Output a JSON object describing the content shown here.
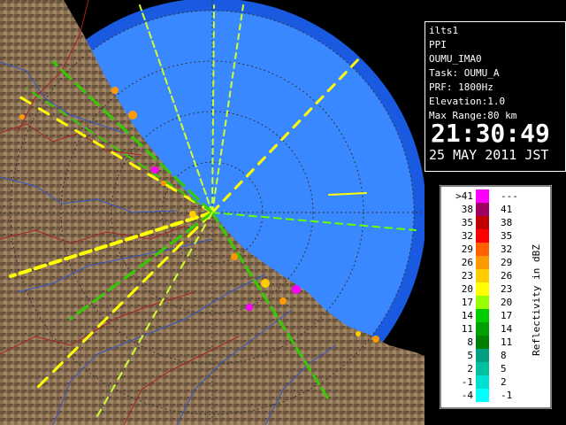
{
  "info": {
    "radar_name": "ilts1",
    "product": "PPI",
    "site": "OUMU_IMA0",
    "task": "Task: OUMU_A",
    "prf": "PRF: 1800Hz",
    "elevation": "Elevation:1.0",
    "max_range": "Max Range:80 km",
    "time": "21:30:49",
    "date": "25 MAY 2011 JST"
  },
  "legend": {
    "title": "Reflectivity in dBZ",
    "rows": [
      {
        "low": ">41",
        "high": "---",
        "color": "#ff00ff"
      },
      {
        "low": "38",
        "high": "41",
        "color": "#a00060"
      },
      {
        "low": "35",
        "high": "38",
        "color": "#c00000"
      },
      {
        "low": "32",
        "high": "35",
        "color": "#ff0000"
      },
      {
        "low": "29",
        "high": "32",
        "color": "#ff6000"
      },
      {
        "low": "26",
        "high": "29",
        "color": "#ff9900"
      },
      {
        "low": "23",
        "high": "26",
        "color": "#ffcc00"
      },
      {
        "low": "20",
        "high": "23",
        "color": "#ffff00"
      },
      {
        "low": "17",
        "high": "20",
        "color": "#99ff00"
      },
      {
        "low": "14",
        "high": "17",
        "color": "#00cc00"
      },
      {
        "low": "11",
        "high": "14",
        "color": "#00a000"
      },
      {
        "low": "8",
        "high": "11",
        "color": "#008000"
      },
      {
        "low": "5",
        "high": "8",
        "color": "#00a080"
      },
      {
        "low": "2",
        "high": "5",
        "color": "#00c0a0"
      },
      {
        "low": "-1",
        "high": "2",
        "color": "#00e0d0"
      },
      {
        "low": "-4",
        "high": "-1",
        "color": "#00ffff"
      }
    ]
  },
  "colors": {
    "radar_range": "#3a88ff",
    "radar_edge": "#1a5ae0",
    "land": "#8a7050",
    "river": "#3355cc",
    "boundary": "#aa2222"
  }
}
